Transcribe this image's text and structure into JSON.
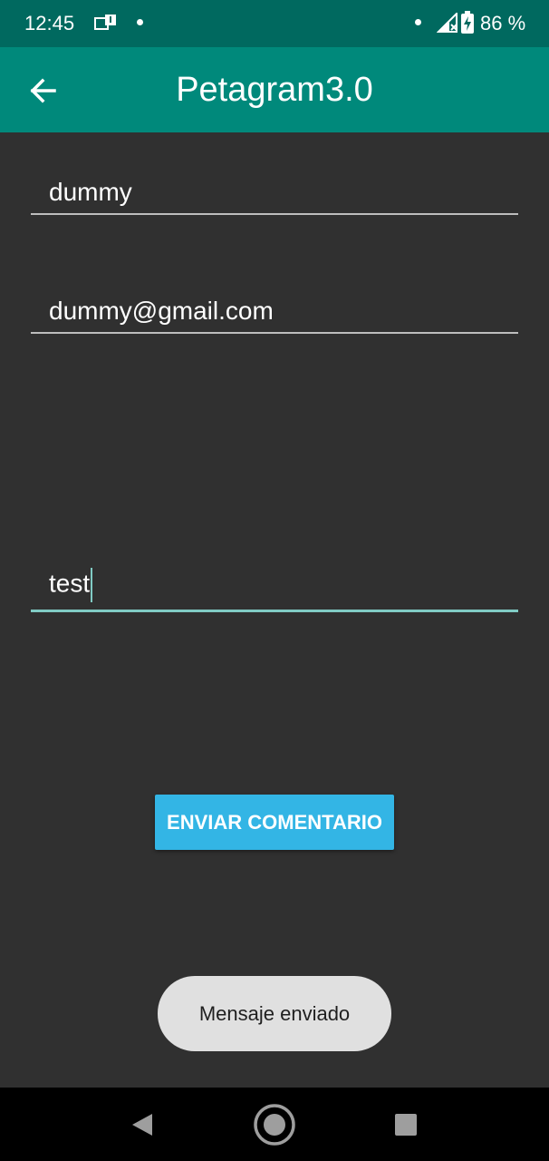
{
  "status_bar": {
    "time": "12:45",
    "battery": "86 %",
    "icons": [
      "notification-icon",
      "dot-icon",
      "signal-icon",
      "battery-charging-icon"
    ]
  },
  "app_bar": {
    "title": "Petagram3.0",
    "back_icon": "arrow-back-icon",
    "color": "#00897b"
  },
  "form": {
    "name_value": "dummy",
    "email_value": "dummy@gmail.com",
    "comment_value": "test",
    "focused_field": "comment"
  },
  "send_button": {
    "label": "ENVIAR COMENTARIO",
    "color": "#33b5e5"
  },
  "toast": {
    "message": "Mensaje enviado"
  },
  "nav_bar": {
    "icons": [
      "back-triangle-icon",
      "home-circle-icon",
      "recents-square-icon"
    ]
  }
}
